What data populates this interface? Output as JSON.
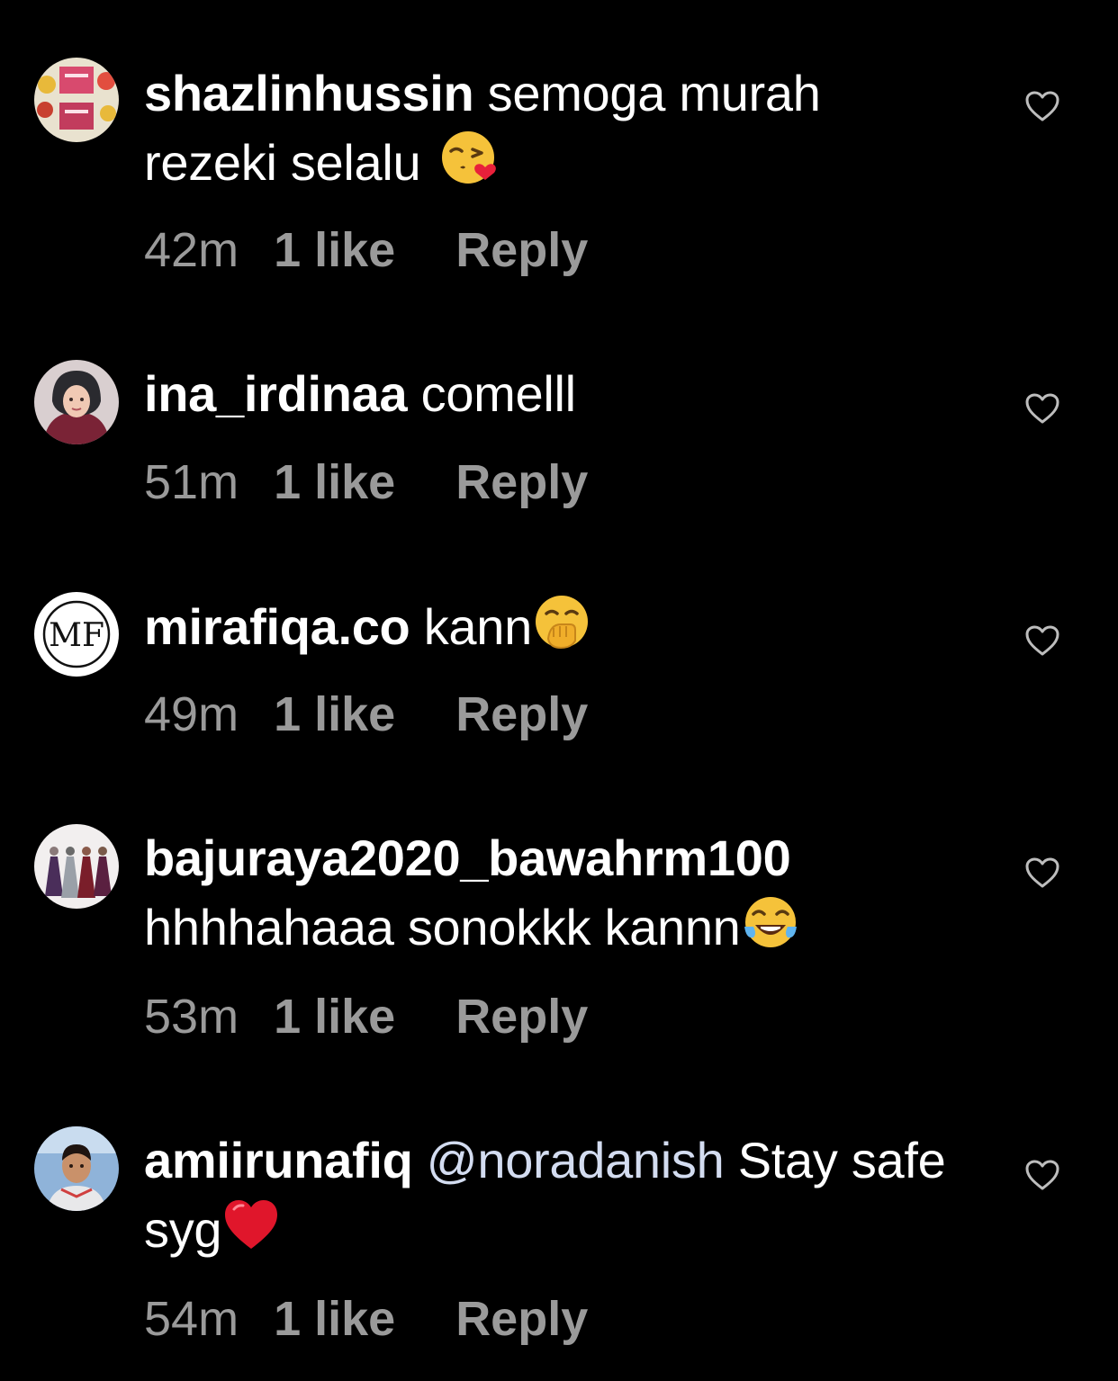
{
  "comments": [
    {
      "username": "shazlinhussin",
      "text": "semoga murah rezeki selalu",
      "mention": "",
      "emoji": "face-blowing-kiss",
      "time": "42m",
      "likes": "1 like",
      "reply": "Reply"
    },
    {
      "username": "ina_irdinaa",
      "text": "comelll",
      "mention": "",
      "emoji": "",
      "time": "51m",
      "likes": "1 like",
      "reply": "Reply"
    },
    {
      "username": "mirafiqa.co",
      "text": "kann",
      "mention": "",
      "emoji": "face-with-hand-over-mouth",
      "time": "49m",
      "likes": "1 like",
      "reply": "Reply"
    },
    {
      "username": "bajuraya2020_bawahrm100",
      "text": "hhhhahaaa sonokkk kannn",
      "mention": "",
      "emoji": "face-with-tears-of-joy",
      "time": "53m",
      "likes": "1 like",
      "reply": "Reply"
    },
    {
      "username": "amiirunafiq",
      "text": "Stay safe syg",
      "mention": "@noradanish",
      "emoji": "red-heart",
      "time": "54m",
      "likes": "1 like",
      "reply": "Reply"
    }
  ],
  "icons": {
    "like": "heart-outline-icon"
  },
  "colors": {
    "background": "#000000",
    "text": "#ffffff",
    "meta": "#9a9a9a",
    "mention": "#d3dcf0"
  }
}
